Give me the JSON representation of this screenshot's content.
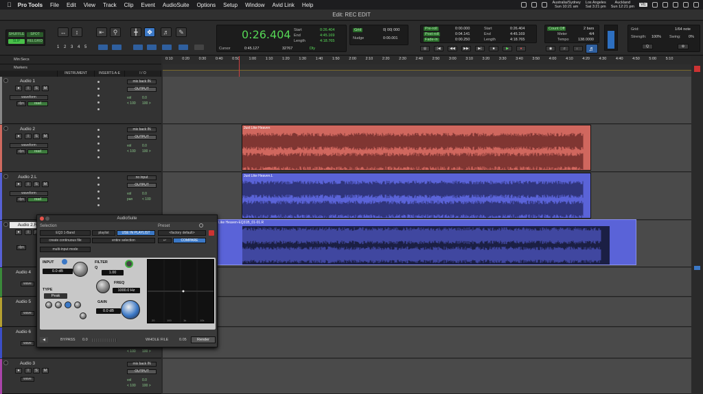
{
  "menubar": {
    "app": "Pro Tools",
    "items": [
      "File",
      "Edit",
      "View",
      "Track",
      "Clip",
      "Event",
      "AudioSuite",
      "Options",
      "Setup",
      "Window",
      "Avid Link",
      "Help"
    ],
    "clocks": [
      {
        "city": "Australia/Sydney",
        "time": "Sun 10:21 am"
      },
      {
        "city": "Los Angeles",
        "time": "Sat 3:21 pm"
      },
      {
        "city": "Auckland",
        "time": "Sun 12:21 pm"
      }
    ],
    "badge": "VE"
  },
  "window": {
    "title": "Edit: REC EDIT"
  },
  "toolbar": {
    "modes": [
      "SHUFFLE",
      "SPOT",
      "SLIP",
      "RELGRID"
    ],
    "zoom_presets": [
      "1",
      "2",
      "3",
      "4",
      "5"
    ],
    "counter": {
      "main": "0:26.404",
      "start_label": "Start",
      "start": "0:26.404",
      "end_label": "End",
      "end": "4:45.169",
      "length_label": "Length",
      "length": "4:18.765",
      "cursor_label": "Cursor",
      "cursor": "0:45.127",
      "sample": "32767",
      "dly": "Dly"
    },
    "grid": {
      "label": "Grid",
      "value": "0| 00| 000",
      "nudge_label": "Nudge",
      "nudge": "0:00.001"
    },
    "preroll": {
      "pre_label": "Pre-roll",
      "pre": "0:00.000",
      "post_label": "Post-roll",
      "post": "0:04.141",
      "fade_label": "Fade-in",
      "fade": "0:00.250",
      "start_label": "Start",
      "start": "0:26.404",
      "end_label": "End",
      "end": "4:45.169",
      "length_label": "Length",
      "length": "4:18.765"
    },
    "countoff": {
      "label": "Count Off",
      "bars": "2 bars",
      "meter_label": "Meter",
      "meter": "4/4",
      "tempo_label": "Tempo",
      "tempo": "138.0000"
    },
    "quant": {
      "grid_label": "Grid:",
      "grid": "1/64 note",
      "strength_label": "Strength:",
      "strength": "100%",
      "swing_label": "Swing:",
      "swing": "0%"
    }
  },
  "edit": {
    "ruler_label": "Min:Secs",
    "markers_label": "Markers",
    "column_headers": [
      "INSTRUMENT",
      "INSERTS A-E",
      "I / O"
    ],
    "ruler_ticks": [
      "0:10",
      "0:20",
      "0:30",
      "0:40",
      "0:50",
      "1:00",
      "1:10",
      "1:20",
      "1:30",
      "1:40",
      "1:50",
      "2:00",
      "2:10",
      "2:20",
      "2:30",
      "2:40",
      "2:50",
      "3:00",
      "3:10",
      "3:20",
      "3:30",
      "3:40",
      "3:50",
      "4:00",
      "4:10",
      "4:20",
      "4:30",
      "4:40",
      "4:50",
      "5:00",
      "5:10"
    ],
    "tracks": [
      {
        "name": "Audio 1",
        "view": "waveform",
        "input": "mix back IN",
        "output": "OUTPUT",
        "vol": "0.0",
        "pan": "< 100",
        "pan2": "100 >",
        "color": "#888"
      },
      {
        "name": "Audio 2",
        "view": "waveform",
        "input": "mix back IN",
        "output": "OUTPUT",
        "vol": "0.0",
        "pan": "< 100",
        "pan2": "100 >",
        "color": "#d06a5f"
      },
      {
        "name": "Audio 2.L",
        "view": "waveform",
        "input": "no input",
        "output": "OUTPUT",
        "vol": "0.0",
        "pan_label": "pan",
        "pan": "< 100",
        "color": "#5661d6"
      },
      {
        "name": "Audio 2.R",
        "view": "",
        "input": "",
        "output": "",
        "vol": "",
        "pan": "",
        "color": "#5661d6"
      },
      {
        "name": "Audio 4",
        "view": "wave",
        "color": "#3a8a3a"
      },
      {
        "name": "Audio 5",
        "view": "wave",
        "color": "#b5a030"
      },
      {
        "name": "Audio 6",
        "view": "wave",
        "vol": "0.0",
        "pan": "< 100",
        "pan2": "100 >",
        "color": "#3b4ec8"
      },
      {
        "name": "Audio 3",
        "view": "wave",
        "input": "mix back IN",
        "output": "OUTPUT",
        "vol": "0.0",
        "pan": "< 100",
        "pan2": "100 >",
        "color": "#aa44aa"
      }
    ],
    "clips": [
      {
        "name": "Just Like Heaven",
        "color": "#d0675e"
      },
      {
        "name": "Just Like Heaven.L",
        "color": "#5a63d8"
      },
      {
        "name": "Like Heaven-EQ31B_01-01.R",
        "color": "#5a63d8"
      }
    ],
    "dyn_label": "dyn",
    "read_label": "read"
  },
  "audiosuite": {
    "title": "AudioSuite",
    "selection_label": "Selection",
    "preset_label": "Preset",
    "plugin": "EQ3 1-Band",
    "playlist": "playlist",
    "use_in_playlist": "USE IN PLAYLIST",
    "preset": "<factory default>",
    "continuous": "create continuous file",
    "entire": "entire selection",
    "compare": "COMPARE",
    "multi": "multi-input mode",
    "input_label": "INPUT",
    "input_val": "0.0 dB",
    "filter_label": "FILTER",
    "filter_q_label": "Q",
    "filter_q": "1.00",
    "freq_label": "FREQ",
    "freq": "1000.0 Hz",
    "type_label": "TYPE",
    "type": "Peak",
    "gain_label": "GAIN",
    "gain": "0.0 dB",
    "graph_ticks": [
      "20",
      "100",
      "1k",
      "10k"
    ],
    "bypass": "BYPASS",
    "bypass_val": "0.0",
    "whole_file": "WHOLE FILE",
    "handle": "0.05",
    "render": "Render"
  }
}
